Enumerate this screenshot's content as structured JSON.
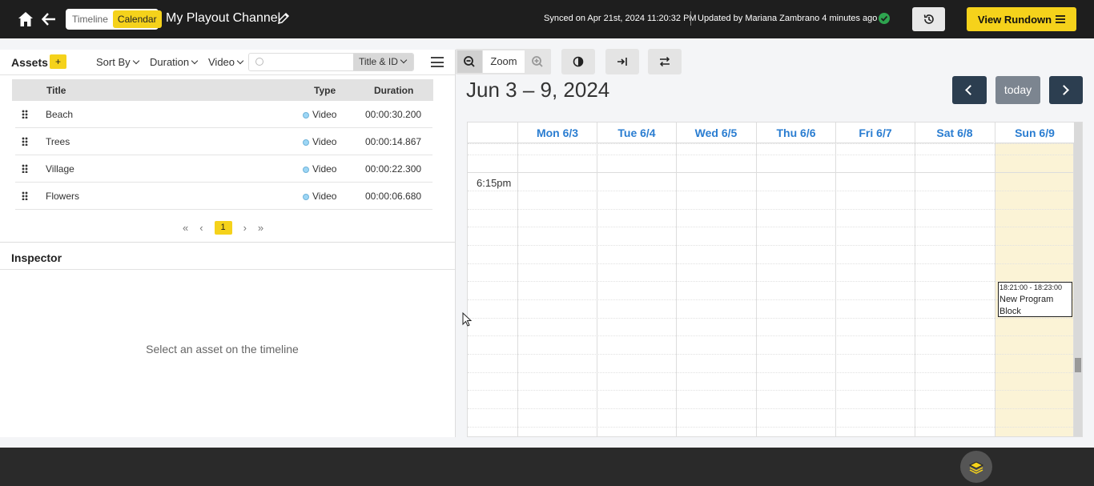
{
  "header": {
    "view_toggle": [
      "Timeline",
      "Calendar"
    ],
    "active_view": "Calendar",
    "channel_title": "My Playout Channel",
    "sync_status": "Synced on Apr 21st, 2024 11:20:32 PM",
    "updated_by": "Updated by Mariana Zambrano 4 minutes ago",
    "view_rundown_label": "View Rundown"
  },
  "assets": {
    "title": "Assets",
    "add_label": "+",
    "filters": [
      "Sort By",
      "Duration",
      "Video"
    ],
    "search_placeholder": "",
    "search_scope": "Title & ID",
    "columns": [
      "Title",
      "Type",
      "Duration"
    ],
    "rows": [
      {
        "title": "Beach",
        "type": "Video",
        "duration": "00:00:30.200"
      },
      {
        "title": "Trees",
        "type": "Video",
        "duration": "00:00:14.867"
      },
      {
        "title": "Village",
        "type": "Video",
        "duration": "00:00:22.300"
      },
      {
        "title": "Flowers",
        "type": "Video",
        "duration": "00:00:06.680"
      }
    ],
    "pager": {
      "first": "«",
      "prev": "‹",
      "current": "1",
      "next": "›",
      "last": "»"
    }
  },
  "inspector": {
    "title": "Inspector",
    "empty_text": "Select an asset on the timeline"
  },
  "calendar": {
    "zoom_label": "Zoom",
    "range_title": "Jun 3 – 9, 2024",
    "today_label": "today",
    "days": [
      "Mon 6/3",
      "Tue 6/4",
      "Wed 6/5",
      "Thu 6/6",
      "Fri 6/7",
      "Sat 6/8",
      "Sun 6/9"
    ],
    "time_label": "6:15pm",
    "event": {
      "time": "18:21:00 - 18:23:00",
      "title": "New Program Block"
    }
  },
  "colors": {
    "accent": "#f5d21b",
    "topbar": "#1e1e1e",
    "day_header": "#2a7dd1",
    "today": "#fbf3d6",
    "nav": "#2c3e50"
  }
}
